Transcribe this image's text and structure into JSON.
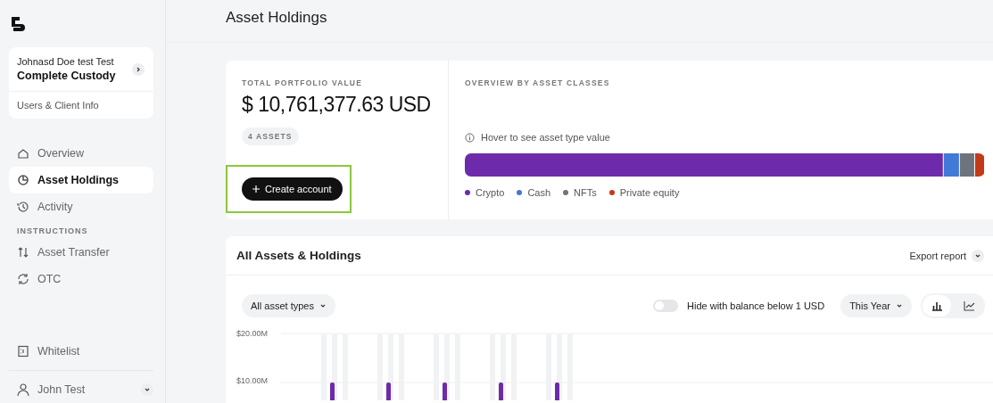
{
  "sidebar": {
    "account": {
      "name": "Johnasd Doe test Test",
      "plan": "Complete Custody",
      "link": "Users & Client Info"
    },
    "nav": [
      {
        "label": "Overview",
        "selected": false
      },
      {
        "label": "Asset Holdings",
        "selected": true
      },
      {
        "label": "Activity",
        "selected": false
      }
    ],
    "section_title": "INSTRUCTIONS",
    "instructions": [
      {
        "label": "Asset Transfer",
        "selected": false
      },
      {
        "label": "OTC",
        "selected": false
      }
    ],
    "bottom": [
      {
        "label": "Whitelist",
        "selected": false
      }
    ],
    "user": {
      "name": "John Test"
    }
  },
  "page_title": "Asset Holdings",
  "summary": {
    "label": "TOTAL PORTFOLIO VALUE",
    "currency_symbol": "$",
    "value": "10,761,377.63",
    "currency": "USD",
    "badge": "4 ASSETS",
    "button": "Create account",
    "highlighted": true
  },
  "overview": {
    "title": "OVERVIEW BY ASSET CLASSES",
    "hint": "Hover to see asset type value",
    "segments": [
      {
        "name": "Crypto",
        "color": "#6d2bab"
      },
      {
        "name": "Cash",
        "color": "#4079d6"
      },
      {
        "name": "NFTs",
        "color": "#6c757d"
      },
      {
        "name": "Private equity",
        "color": "#c4391a"
      }
    ]
  },
  "holdings": {
    "title": "All Assets & Holdings",
    "export": "Export report",
    "filter": "All asset types",
    "hide_toggle": {
      "label": "Hide with balance below 1 USD",
      "on": false
    },
    "period": "This Year",
    "views": [
      {
        "kind": "bar",
        "selected": true
      },
      {
        "kind": "line",
        "selected": false
      }
    ],
    "y_axis_labels": [
      "$20.00M",
      "$10.00M"
    ]
  }
}
